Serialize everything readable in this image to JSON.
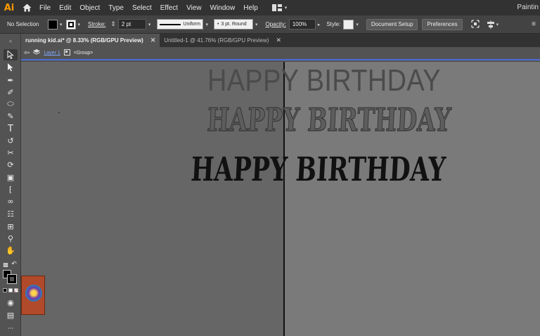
{
  "menubar": {
    "logo": "Ai",
    "items": [
      "File",
      "Edit",
      "Object",
      "Type",
      "Select",
      "Effect",
      "View",
      "Window",
      "Help"
    ],
    "workspace": "Paintin"
  },
  "controlbar": {
    "selection": "No Selection",
    "stroke_label": "Stroke:",
    "stroke_weight": "2 pt",
    "profile": "Uniform",
    "brush": "3 pt. Round",
    "opacity_label": "Opacity:",
    "opacity_value": "100%",
    "style_label": "Style:",
    "document_setup": "Document Setup",
    "preferences": "Preferences"
  },
  "tabs": [
    {
      "label": "running kid.ai* @ 8.33% (RGB/GPU Preview)",
      "active": true
    },
    {
      "label": "Untitled-1 @ 41.76% (RGB/GPU Preview)",
      "active": false
    }
  ],
  "breadcrumb": {
    "layer": "Layer 1",
    "group": "<Group>"
  },
  "canvas": {
    "texts": [
      "HAPPY BIRTHDAY",
      "HAPPY BIRTHDAY",
      "HAPPY BIRTHDAY"
    ]
  },
  "colors": {
    "app_bg": "#535353",
    "menubar": "#323232",
    "accent_blue": "#4a6fd8",
    "ai_orange": "#ff9a00"
  }
}
